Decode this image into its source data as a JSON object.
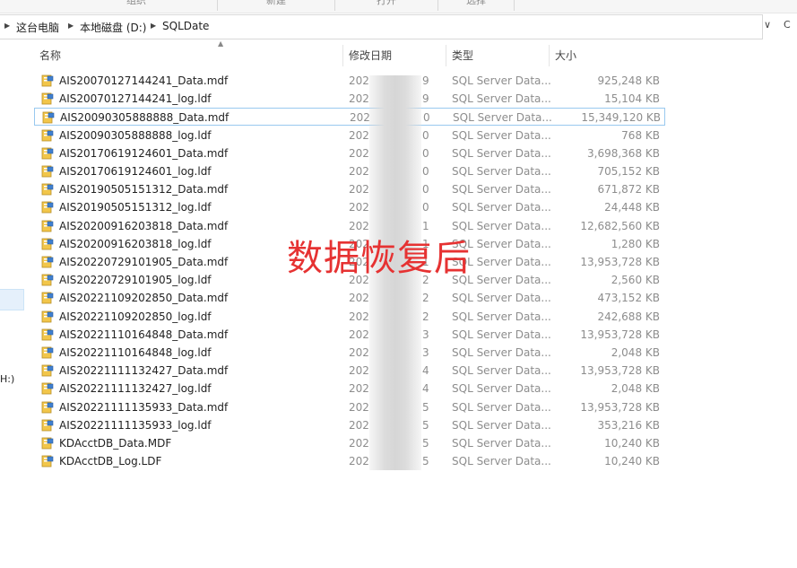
{
  "ribbon": {
    "groups": [
      "组织",
      "新建",
      "打开",
      "选择"
    ]
  },
  "address": {
    "segments": [
      "这台电脑",
      "本地磁盘 (D:)",
      "SQLDate"
    ],
    "dropdown_glyph": "∨",
    "refresh_glyph": "C"
  },
  "nav": {
    "partial_label": "H:)"
  },
  "columns": {
    "name": "名称",
    "date": "修改日期",
    "type": "类型",
    "size": "大小"
  },
  "files": [
    {
      "name": "AIS20070127144241_Data.mdf",
      "date": "202",
      "date_tail": "9",
      "type": "SQL Server Data...",
      "size": "925,248 KB"
    },
    {
      "name": "AIS20070127144241_log.ldf",
      "date": "202",
      "date_tail": "9",
      "type": "SQL Server Data...",
      "size": "15,104 KB"
    },
    {
      "name": "AIS20090305888888_Data.mdf",
      "date": "202",
      "date_tail": "0",
      "type": "SQL Server Data...",
      "size": "15,349,120 KB"
    },
    {
      "name": "AIS20090305888888_log.ldf",
      "date": "202",
      "date_tail": "0",
      "type": "SQL Server Data...",
      "size": "768 KB"
    },
    {
      "name": "AIS20170619124601_Data.mdf",
      "date": "202",
      "date_tail": "0",
      "type": "SQL Server Data...",
      "size": "3,698,368 KB"
    },
    {
      "name": "AIS20170619124601_log.ldf",
      "date": "202",
      "date_tail": "0",
      "type": "SQL Server Data...",
      "size": "705,152 KB"
    },
    {
      "name": "AIS20190505151312_Data.mdf",
      "date": "202",
      "date_tail": "0",
      "type": "SQL Server Data...",
      "size": "671,872 KB"
    },
    {
      "name": "AIS20190505151312_log.ldf",
      "date": "202",
      "date_tail": "0",
      "type": "SQL Server Data...",
      "size": "24,448 KB"
    },
    {
      "name": "AIS20200916203818_Data.mdf",
      "date": "202",
      "date_tail": "1",
      "type": "SQL Server Data...",
      "size": "12,682,560 KB"
    },
    {
      "name": "AIS20200916203818_log.ldf",
      "date": "202",
      "date_tail": "1",
      "type": "SQL Server Data...",
      "size": "1,280 KB"
    },
    {
      "name": "AIS20220729101905_Data.mdf",
      "date": "202",
      "date_tail": "1",
      "type": "SQL Server Data...",
      "size": "13,953,728 KB"
    },
    {
      "name": "AIS20220729101905_log.ldf",
      "date": "202",
      "date_tail": "2",
      "type": "SQL Server Data...",
      "size": "2,560 KB"
    },
    {
      "name": "AIS20221109202850_Data.mdf",
      "date": "202",
      "date_tail": "2",
      "type": "SQL Server Data...",
      "size": "473,152 KB"
    },
    {
      "name": "AIS20221109202850_log.ldf",
      "date": "202",
      "date_tail": "2",
      "type": "SQL Server Data...",
      "size": "242,688 KB"
    },
    {
      "name": "AIS20221110164848_Data.mdf",
      "date": "202",
      "date_tail": "3",
      "type": "SQL Server Data...",
      "size": "13,953,728 KB"
    },
    {
      "name": "AIS20221110164848_log.ldf",
      "date": "202",
      "date_tail": "3",
      "type": "SQL Server Data...",
      "size": "2,048 KB"
    },
    {
      "name": "AIS20221111132427_Data.mdf",
      "date": "202",
      "date_tail": "4",
      "type": "SQL Server Data...",
      "size": "13,953,728 KB"
    },
    {
      "name": "AIS20221111132427_log.ldf",
      "date": "202",
      "date_tail": "4",
      "type": "SQL Server Data...",
      "size": "2,048 KB"
    },
    {
      "name": "AIS20221111135933_Data.mdf",
      "date": "202",
      "date_tail": "5",
      "type": "SQL Server Data...",
      "size": "13,953,728 KB"
    },
    {
      "name": "AIS20221111135933_log.ldf",
      "date": "202",
      "date_tail": "5",
      "type": "SQL Server Data...",
      "size": "353,216 KB"
    },
    {
      "name": "KDAcctDB_Data.MDF",
      "date": "202",
      "date_tail": "5",
      "type": "SQL Server Data...",
      "size": "10,240 KB"
    },
    {
      "name": "KDAcctDB_Log.LDF",
      "date": "202",
      "date_tail": "5",
      "type": "SQL Server Data...",
      "size": "10,240 KB"
    }
  ],
  "focused_row": 2,
  "overlay_text": "数据恢复后",
  "colors": {
    "overlay": "#e63232",
    "focus_border": "#99c9ef",
    "icon_yellow": "#f2c64a",
    "icon_blue": "#3f7fcf"
  },
  "icons": {
    "file": "sql-database-file-icon"
  }
}
